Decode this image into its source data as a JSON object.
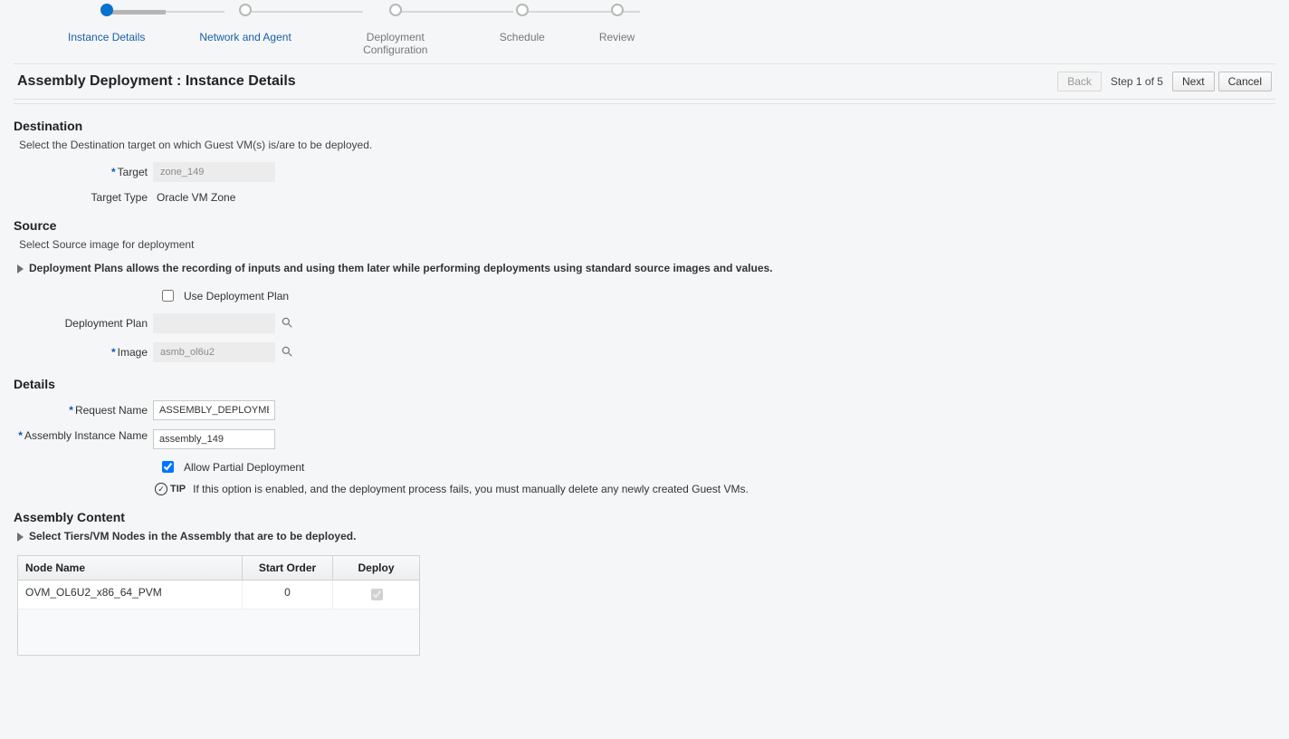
{
  "wizard": {
    "steps": [
      {
        "label": "Instance Details"
      },
      {
        "label": "Network and Agent"
      },
      {
        "label": "Deployment Configuration"
      },
      {
        "label": "Schedule"
      },
      {
        "label": "Review"
      }
    ]
  },
  "header": {
    "title": "Assembly Deployment : Instance Details",
    "back": "Back",
    "step_indicator": "Step 1 of 5",
    "next": "Next",
    "cancel": "Cancel"
  },
  "destination": {
    "title": "Destination",
    "desc": "Select the Destination target on which Guest VM(s) is/are to be deployed.",
    "target_label": "Target",
    "target_value": "zone_149",
    "target_type_label": "Target Type",
    "target_type_value": "Oracle VM Zone"
  },
  "source": {
    "title": "Source",
    "desc": "Select Source image for deployment",
    "plan_hint": "Deployment Plans allows the recording of inputs and using them later while performing deployments using standard source images and values.",
    "use_plan_label": "Use Deployment Plan",
    "deployment_plan_label": "Deployment Plan",
    "deployment_plan_value": "",
    "image_label": "Image",
    "image_value": "asmb_ol6u2"
  },
  "details": {
    "title": "Details",
    "request_name_label": "Request Name",
    "request_name_value": "ASSEMBLY_DEPLOYMENT",
    "assembly_instance_label": "Assembly Instance Name",
    "assembly_instance_value": "assembly_149",
    "allow_partial_label": "Allow Partial Deployment",
    "tip_label": "TIP",
    "tip_text": "If this option is enabled, and the deployment process fails, you must manually delete any newly created Guest VMs."
  },
  "assembly": {
    "title": "Assembly Content",
    "hint": "Select Tiers/VM Nodes in the Assembly that are to be deployed.",
    "columns": {
      "node": "Node Name",
      "start": "Start Order",
      "deploy": "Deploy"
    },
    "rows": [
      {
        "node": "OVM_OL6U2_x86_64_PVM",
        "start": "0",
        "deploy": true
      }
    ]
  }
}
